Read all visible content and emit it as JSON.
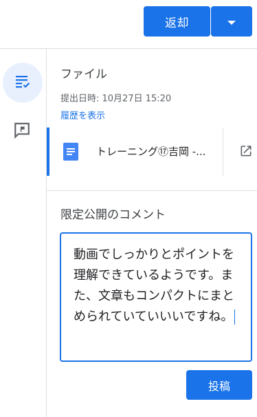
{
  "header": {
    "return_label": "返却",
    "dropdown_icon": "caret-down-icon"
  },
  "sidebar": {
    "items": [
      {
        "icon": "assignment-list-icon",
        "active": true
      },
      {
        "icon": "private-comment-icon",
        "active": false
      }
    ]
  },
  "file_section": {
    "title": "ファイル",
    "submitted": "提出日時: 10月27日 15:20",
    "history_link": "履歴を表示",
    "file": {
      "name": "トレーニング⑰吉岡 -...",
      "icon": "google-docs-icon",
      "open_icon": "open-in-new-icon"
    }
  },
  "comment_section": {
    "title": "限定公開のコメント",
    "text": "動画でしっかりとポイントを理解できているようです。また、文章もコンパクトにまとめられていていいいですね。",
    "post_label": "投稿"
  },
  "colors": {
    "accent": "#1a73e8",
    "active_bg": "#e8f0fe"
  }
}
